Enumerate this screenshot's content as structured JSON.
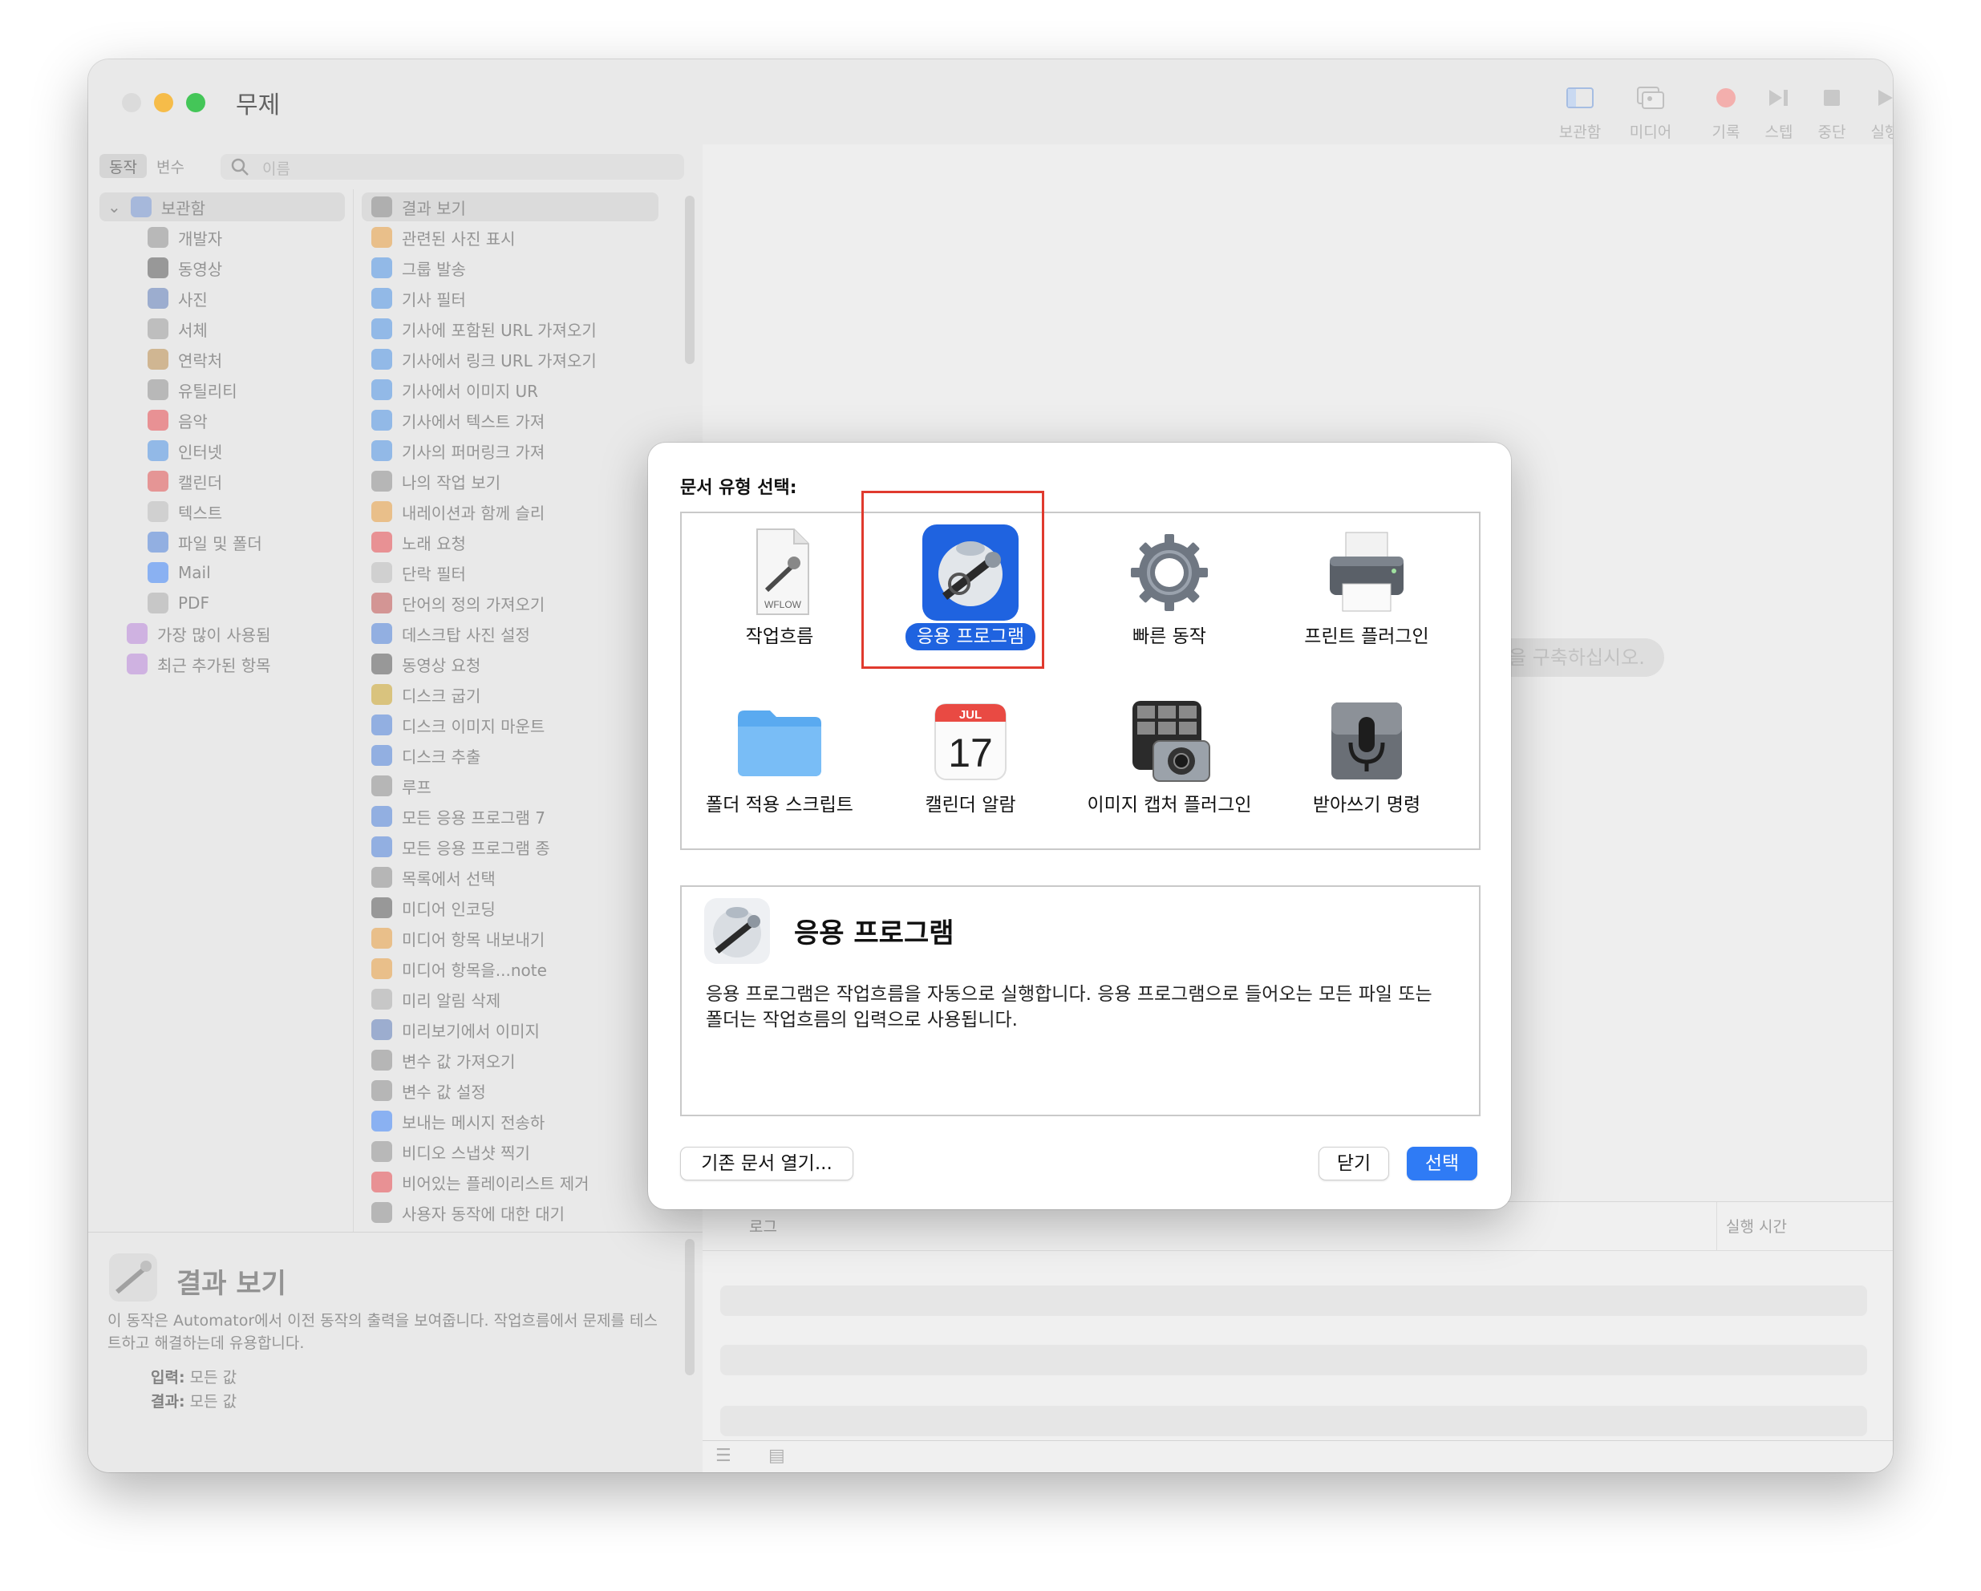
{
  "window": {
    "title": "무제"
  },
  "toolbar": {
    "buttons": [
      {
        "label": "보관함",
        "icon": "library-panel-icon"
      },
      {
        "label": "미디어",
        "icon": "media-icon"
      },
      {
        "label": "기록",
        "icon": "record-icon"
      },
      {
        "label": "스텝",
        "icon": "step-icon"
      },
      {
        "label": "중단",
        "icon": "stop-icon"
      },
      {
        "label": "실행",
        "icon": "run-icon"
      }
    ]
  },
  "left": {
    "segments": [
      "동작",
      "변수"
    ],
    "search_placeholder": "이름",
    "library": [
      {
        "label": "보관함",
        "color": "#7a9ad8"
      },
      {
        "label": "개발자",
        "color": "#8e8e8e"
      },
      {
        "label": "동영상",
        "color": "#555555"
      },
      {
        "label": "사진",
        "color": "#5b7bb8"
      },
      {
        "label": "서체",
        "color": "#9a9a9a"
      },
      {
        "label": "연락처",
        "color": "#b98a4a"
      },
      {
        "label": "유틸리티",
        "color": "#8e8e8e"
      },
      {
        "label": "음악",
        "color": "#e5484d"
      },
      {
        "label": "인터넷",
        "color": "#4a90e2"
      },
      {
        "label": "캘린더",
        "color": "#e05050"
      },
      {
        "label": "텍스트",
        "color": "#bbbbbb"
      },
      {
        "label": "파일 및 폴더",
        "color": "#4a7fd8"
      },
      {
        "label": "Mail",
        "color": "#3b82f6"
      },
      {
        "label": "PDF",
        "color": "#aaaaaa"
      },
      {
        "label": "가장 많이 사용됨",
        "color": "#b884d8"
      },
      {
        "label": "최근 추가된 항목",
        "color": "#b884d8"
      }
    ],
    "actions": [
      "결과 보기",
      "관련된 사진 표시",
      "그룹 발송",
      "기사 필터",
      "기사에 포함된 URL 가져오기",
      "기사에서 링크 URL 가져오기",
      "기사에서 이미지 UR",
      "기사에서 텍스트 가져",
      "기사의 퍼머링크 가져",
      "나의 작업 보기",
      "내레이션과 함께 슬리",
      "노래 요청",
      "단락 필터",
      "단어의 정의 가져오기",
      "데스크탑 사진 설정",
      "동영상 요청",
      "디스크 굽기",
      "디스크 이미지 마운트",
      "디스크 추출",
      "루프",
      "모든 응용 프로그램 7",
      "모든 응용 프로그램 종",
      "목록에서 선택",
      "미디어 인코딩",
      "미디어 항목 내보내기",
      "미디어 항목을...note",
      "미리 알림 삭제",
      "미리보기에서 이미지",
      "변수 값 가져오기",
      "변수 값 설정",
      "보내는 메시지 전송하",
      "비디오 스냅샷 찍기",
      "비어있는 플레이리스트 제거",
      "사용자 동작에 대한 대기"
    ],
    "action_colors": [
      "#8a8a8a",
      "#e89b3a",
      "#4a90e2",
      "#4a90e2",
      "#4a90e2",
      "#4a90e2",
      "#4a90e2",
      "#4a90e2",
      "#4a90e2",
      "#8a8a8a",
      "#e89b3a",
      "#e5484d",
      "#bbbbbb",
      "#c0504d",
      "#4a7fd8",
      "#555555",
      "#c9a227",
      "#4a7fd8",
      "#4a7fd8",
      "#8a8a8a",
      "#4a7fd8",
      "#4a7fd8",
      "#8a8a8a",
      "#555555",
      "#e89b3a",
      "#e89b3a",
      "#aaaaaa",
      "#5b7bb8",
      "#8a8a8a",
      "#8a8a8a",
      "#3b82f6",
      "#8e8e8e",
      "#e5484d",
      "#8a8a8a"
    ],
    "description": {
      "title": "결과 보기",
      "text": "이 동작은 Automator에서 이전 동작의 출력을 보여줍니다. 작업흐름에서 문제를 테스트하고 해결하는데 유용합니다.",
      "input_label": "입력:",
      "input_value": "모든 값",
      "result_label": "결과:",
      "result_value": "모든 값"
    }
  },
  "right": {
    "hint_text": "을 구축하십시오.",
    "log_header": "로그",
    "time_header": "실행 시간"
  },
  "dialog": {
    "label": "문서 유형 선택:",
    "types": [
      {
        "name": "작업흐름",
        "icon": "workflow-document-icon",
        "selected": false
      },
      {
        "name": "응용 프로그램",
        "icon": "automator-application-icon",
        "selected": true
      },
      {
        "name": "빠른 동작",
        "icon": "gear-icon",
        "selected": false
      },
      {
        "name": "프린트 플러그인",
        "icon": "printer-icon",
        "selected": false
      },
      {
        "name": "폴더 적용 스크립트",
        "icon": "folder-icon",
        "selected": false
      },
      {
        "name": "캘린더 알람",
        "icon": "calendar-icon",
        "selected": false
      },
      {
        "name": "이미지 캡처 플러그인",
        "icon": "image-capture-icon",
        "selected": false
      },
      {
        "name": "받아쓰기 명령",
        "icon": "microphone-icon",
        "selected": false
      }
    ],
    "workflow_badge": "WFLOW",
    "calendar_month": "JUL",
    "calendar_day": "17",
    "info": {
      "title": "응용 프로그램",
      "text": "응용 프로그램은 작업흐름을 자동으로 실행합니다. 응용 프로그램으로 들어오는 모든 파일 또는 폴더는 작업흐름의 입력으로 사용됩니다."
    },
    "buttons": {
      "open_existing": "기존 문서 열기...",
      "close": "닫기",
      "choose": "선택"
    },
    "accent": "#1f63e0"
  }
}
